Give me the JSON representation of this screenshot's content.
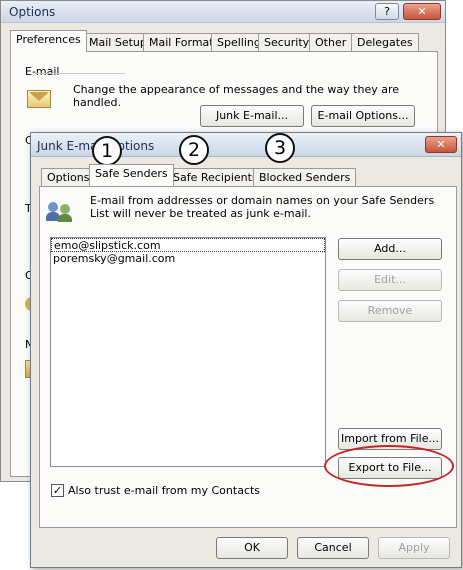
{
  "options_window": {
    "title": "Options",
    "help_btn": "?",
    "close_btn": "✕",
    "tabs": [
      "Preferences",
      "Mail Setup",
      "Mail Format",
      "Spelling",
      "Security",
      "Other",
      "Delegates"
    ],
    "section_email": "E-mail",
    "email_desc": "Change the appearance of messages and the way they are handled.",
    "junk_btn": "Junk E-mail...",
    "email_options_btn": "E-mail Options...",
    "partial_letters": [
      "C",
      "T",
      "O",
      "N"
    ]
  },
  "junk_dialog": {
    "title": "Junk E-mail Options",
    "close_btn": "✕",
    "tabs": [
      "Options",
      "Safe Senders",
      "Safe Recipients",
      "Blocked Senders"
    ],
    "description": "E-mail from addresses or domain names on your Safe Senders List will never be treated as junk e-mail.",
    "senders": [
      "emo@slipstick.com",
      "poremsky@gmail.com"
    ],
    "buttons": {
      "add": "Add...",
      "edit": "Edit...",
      "remove": "Remove",
      "import": "Import from File...",
      "export": "Export to File..."
    },
    "trust_contacts_label": "Also trust e-mail from my Contacts",
    "trust_contacts_checked": true,
    "ok": "OK",
    "cancel": "Cancel",
    "apply": "Apply"
  },
  "callouts": [
    "1",
    "2",
    "3"
  ],
  "colors": {
    "highlight_oval": "#c0282a"
  }
}
